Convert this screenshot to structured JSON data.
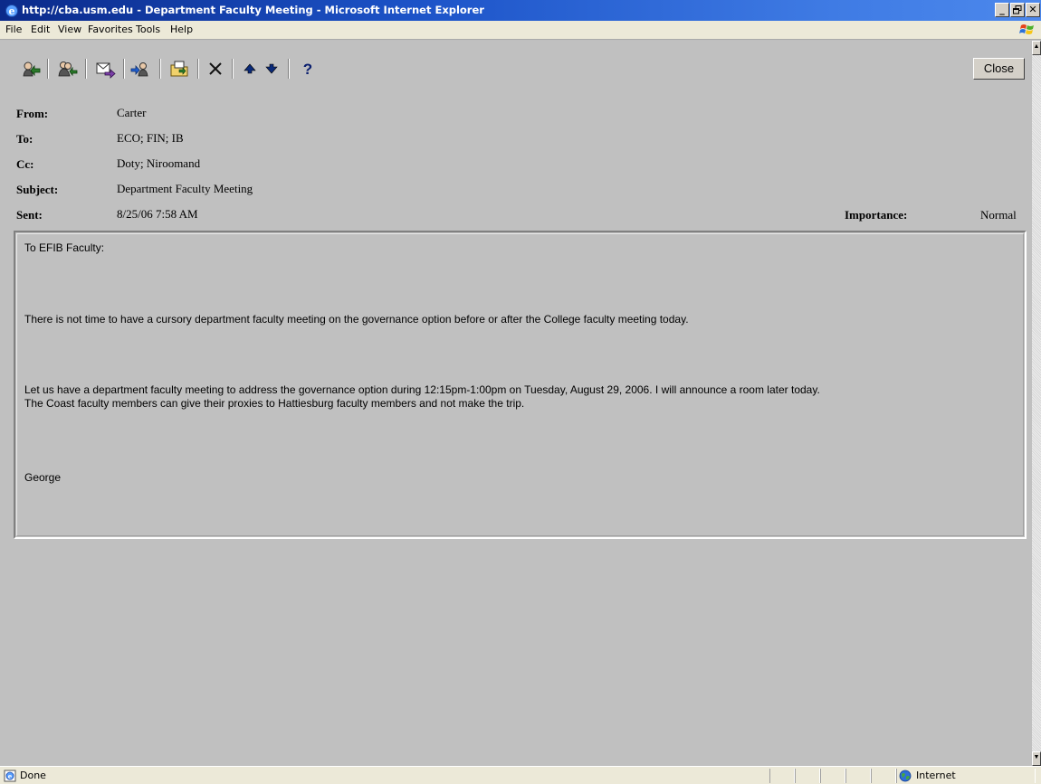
{
  "window": {
    "title": "http://cba.usm.edu - Department Faculty Meeting - Microsoft Internet Explorer",
    "minimize_label": "_",
    "maximize_label": "▫",
    "close_label": "✕"
  },
  "menu": {
    "items": [
      "File",
      "Edit",
      "View",
      "Favorites",
      "Tools",
      "Help"
    ]
  },
  "toolbar": {
    "icons": [
      "reply-icon",
      "reply-all-icon",
      "forward-icon",
      "send-receive-icon",
      "move-to-folder-icon",
      "delete-icon",
      "previous-item-icon",
      "next-item-icon",
      "help-icon"
    ],
    "close_label": "Close"
  },
  "message": {
    "from_label": "From:",
    "from": "Carter",
    "to_label": "To:",
    "to": "ECO; FIN; IB",
    "cc_label": "Cc:",
    "cc": "Doty; Niroomand",
    "subject_label": "Subject:",
    "subject": "Department Faculty Meeting",
    "sent_label": "Sent:",
    "sent": "8/25/06 7:58 AM",
    "importance_label": "Importance:",
    "importance": "Normal",
    "body": {
      "greeting": "To EFIB Faculty:",
      "p1": "There is not time to have a cursory department faculty meeting on the governance option before or after the College faculty meeting today.",
      "p2_line1": "Let us have a department faculty meeting to address the governance option during 12:15pm-1:00pm on Tuesday, August 29, 2006.  I will announce a room later today.",
      "p2_line2": "The Coast faculty members can give their proxies to Hattiesburg faculty members and not make the trip.",
      "signature": "George"
    }
  },
  "status": {
    "text": "Done",
    "zone": "Internet"
  }
}
